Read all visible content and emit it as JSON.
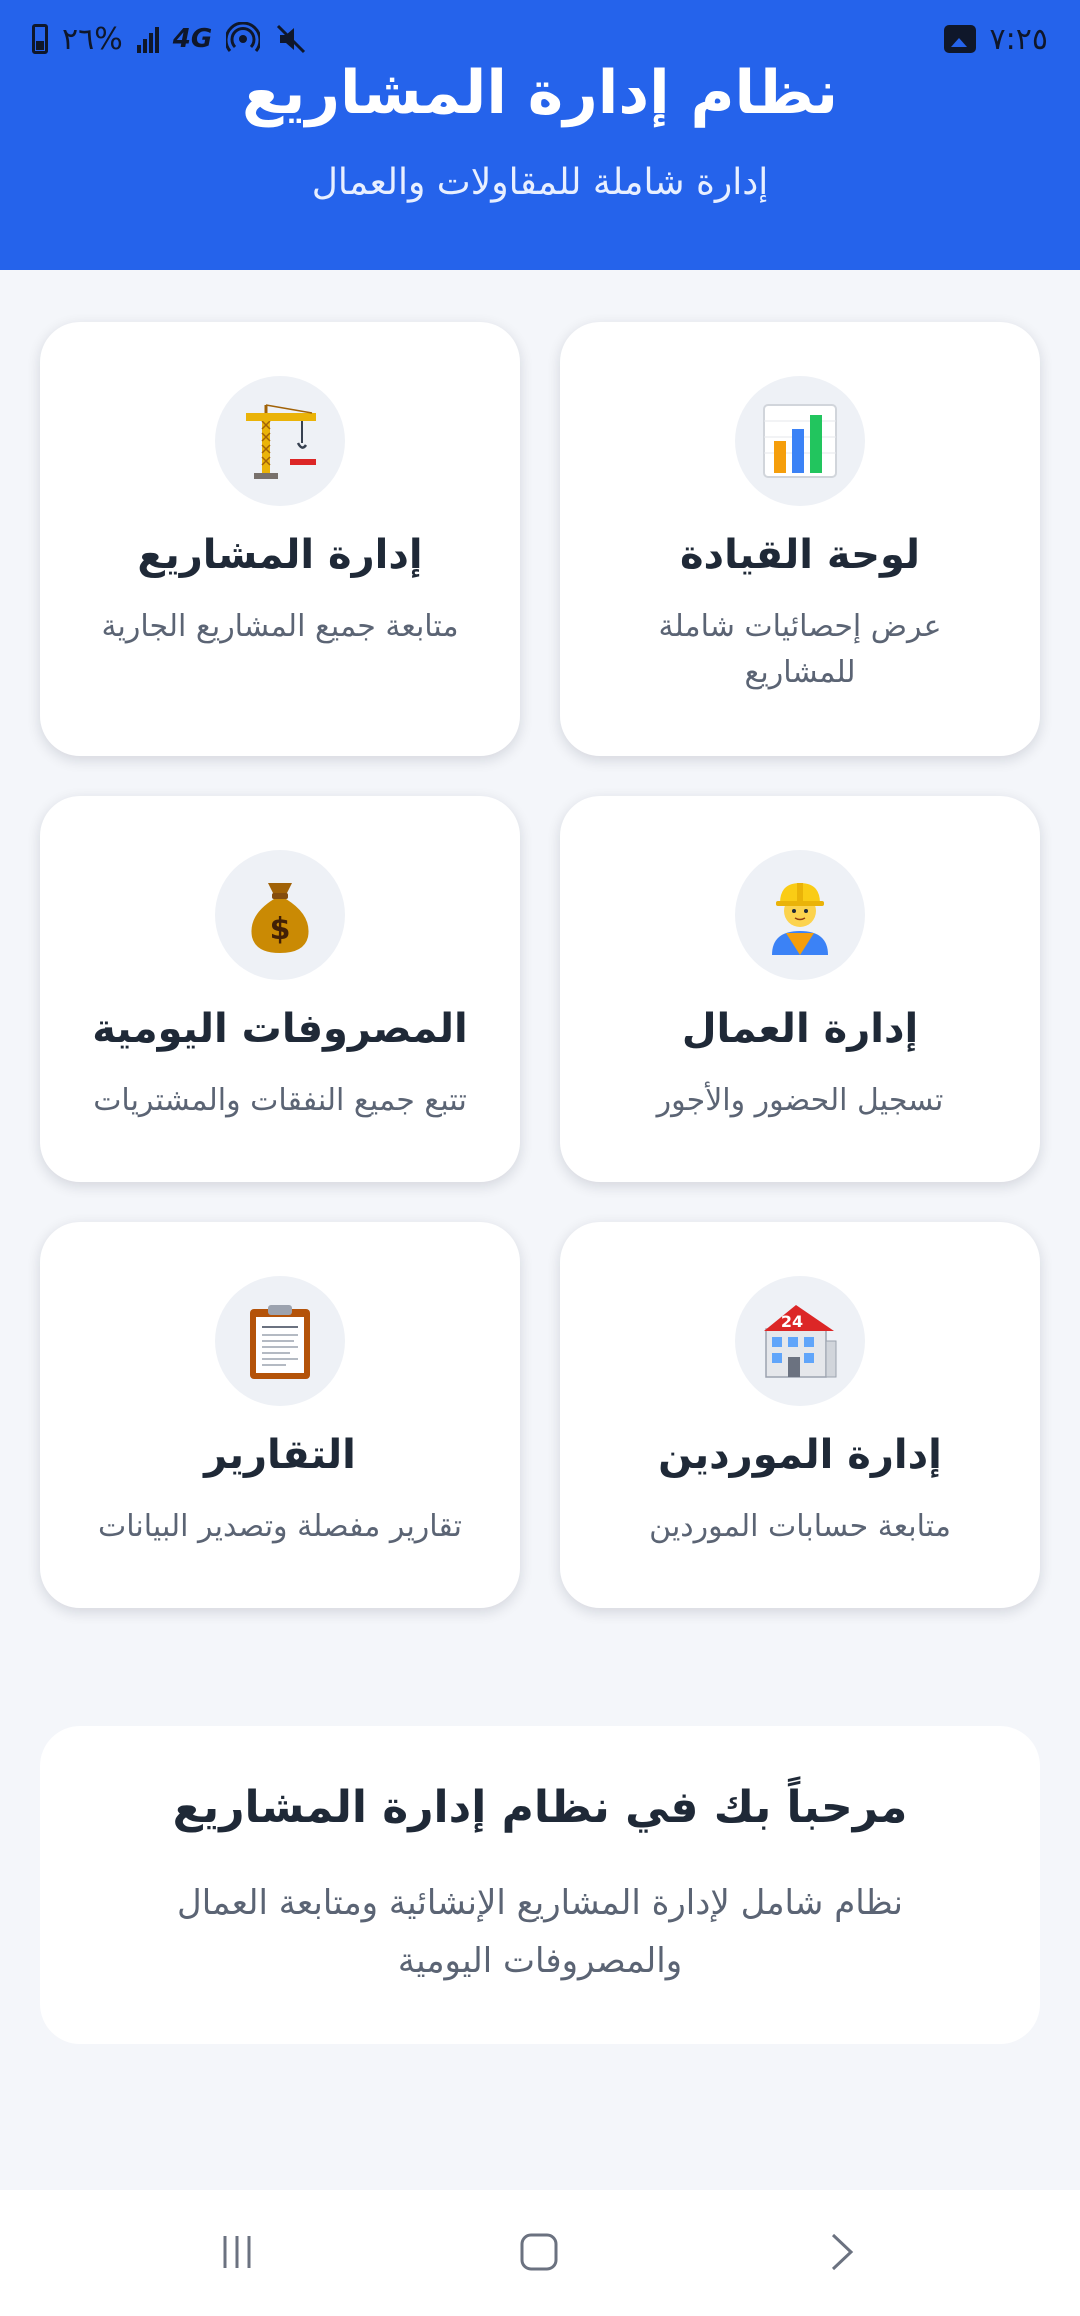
{
  "status_bar": {
    "time": "٧:٢٥",
    "battery": "٢٦%",
    "network": "4G"
  },
  "header": {
    "title": "نظام إدارة المشاريع",
    "subtitle": "إدارة شاملة للمقاولات والعمال"
  },
  "cards": [
    {
      "title": "لوحة القيادة",
      "description": "عرض إحصائيات شاملة للمشاريع",
      "icon": "bar-chart-icon"
    },
    {
      "title": "إدارة المشاريع",
      "description": "متابعة جميع المشاريع الجارية",
      "icon": "crane-icon"
    },
    {
      "title": "إدارة العمال",
      "description": "تسجيل الحضور والأجور",
      "icon": "construction-worker-icon"
    },
    {
      "title": "المصروفات اليومية",
      "description": "تتبع جميع النفقات والمشتريات",
      "icon": "money-bag-icon"
    },
    {
      "title": "إدارة الموردين",
      "description": "متابعة حسابات الموردين",
      "icon": "building-icon"
    },
    {
      "title": "التقارير",
      "description": "تقارير مفصلة وتصدير البيانات",
      "icon": "clipboard-icon"
    }
  ],
  "welcome": {
    "title": "مرحباً بك في نظام إدارة المشاريع",
    "text": "نظام شامل لإدارة المشاريع الإنشائية ومتابعة العمال والمصروفات اليومية"
  },
  "colors": {
    "header_background": "#2563eb",
    "page_background": "#f4f6fa",
    "card_background": "#ffffff"
  }
}
